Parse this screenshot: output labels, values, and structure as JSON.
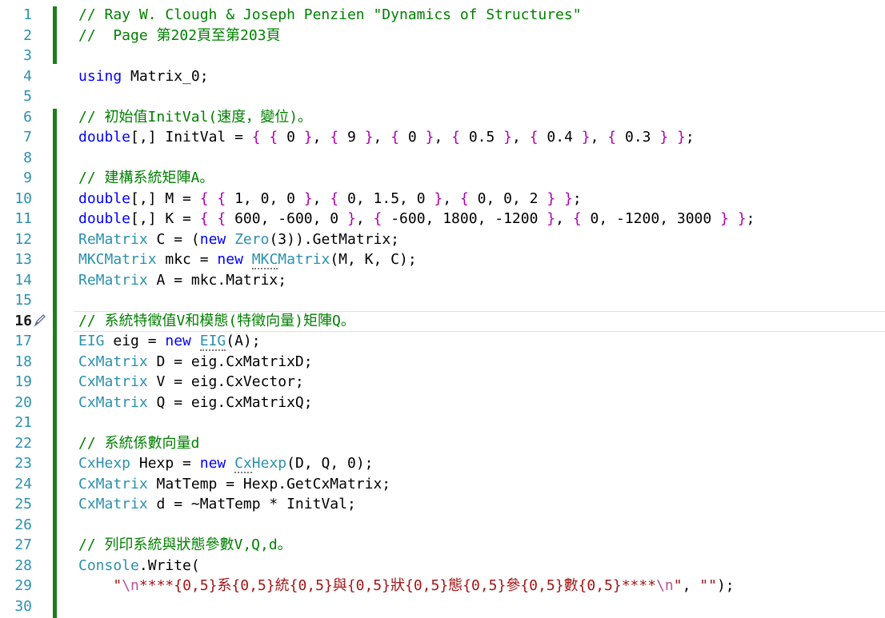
{
  "editor": {
    "colors": {
      "comment": "#008000",
      "keyword": "#0000ff",
      "type": "#2b91af",
      "number": "#098658",
      "string": "#a31515",
      "line_number": "#2b91af",
      "change_bar": "#1a7f1a"
    },
    "current_line": 16,
    "gutter_icon": "pencil-icon",
    "lines": [
      {
        "n": "1",
        "tokens": [
          [
            "c",
            "// Ray W. Clough & Joseph Penzien \"Dynamics of Structures\""
          ]
        ]
      },
      {
        "n": "2",
        "tokens": [
          [
            "c",
            "//  Page 第202頁至第203頁"
          ]
        ]
      },
      {
        "n": "3",
        "tokens": []
      },
      {
        "n": "4",
        "tokens": [
          [
            "k",
            "using"
          ],
          [
            "p",
            " Matrix_0;"
          ]
        ]
      },
      {
        "n": "5",
        "tokens": []
      },
      {
        "n": "6",
        "tokens": [
          [
            "c",
            "// 初始值InitVal(速度，變位)。"
          ]
        ]
      },
      {
        "n": "7",
        "tokens": [
          [
            "k",
            "double"
          ],
          [
            "p",
            "[,] InitVal = "
          ],
          [
            "b",
            "{ { "
          ],
          [
            "p",
            "0"
          ],
          [
            "b",
            " }"
          ],
          [
            "p",
            ", "
          ],
          [
            "b",
            "{ "
          ],
          [
            "p",
            "9"
          ],
          [
            "b",
            " }"
          ],
          [
            "p",
            ", "
          ],
          [
            "b",
            "{ "
          ],
          [
            "p",
            "0"
          ],
          [
            "b",
            " }"
          ],
          [
            "p",
            ", "
          ],
          [
            "b",
            "{ "
          ],
          [
            "p",
            "0.5"
          ],
          [
            "b",
            " }"
          ],
          [
            "p",
            ", "
          ],
          [
            "b",
            "{ "
          ],
          [
            "p",
            "0.4"
          ],
          [
            "b",
            " }"
          ],
          [
            "p",
            ", "
          ],
          [
            "b",
            "{ "
          ],
          [
            "p",
            "0.3"
          ],
          [
            "b",
            " } }"
          ],
          [
            "p",
            ";"
          ]
        ]
      },
      {
        "n": "8",
        "tokens": []
      },
      {
        "n": "9",
        "tokens": [
          [
            "c",
            "// 建構系統矩陣A。"
          ]
        ]
      },
      {
        "n": "10",
        "tokens": [
          [
            "k",
            "double"
          ],
          [
            "p",
            "[,] M = "
          ],
          [
            "b",
            "{ { "
          ],
          [
            "p",
            "1, 0, 0"
          ],
          [
            "b",
            " }"
          ],
          [
            "p",
            ", "
          ],
          [
            "b",
            "{ "
          ],
          [
            "p",
            "0, 1.5, 0"
          ],
          [
            "b",
            " }"
          ],
          [
            "p",
            ", "
          ],
          [
            "b",
            "{ "
          ],
          [
            "p",
            "0, 0, 2"
          ],
          [
            "b",
            " } }"
          ],
          [
            "p",
            ";"
          ]
        ]
      },
      {
        "n": "11",
        "tokens": [
          [
            "k",
            "double"
          ],
          [
            "p",
            "[,] K = "
          ],
          [
            "b",
            "{ { "
          ],
          [
            "p",
            "600, -600, 0"
          ],
          [
            "b",
            " }"
          ],
          [
            "p",
            ", "
          ],
          [
            "b",
            "{ "
          ],
          [
            "p",
            "-600, 1800, -1200"
          ],
          [
            "b",
            " }"
          ],
          [
            "p",
            ", "
          ],
          [
            "b",
            "{ "
          ],
          [
            "p",
            "0, -1200, 3000"
          ],
          [
            "b",
            " } }"
          ],
          [
            "p",
            ";"
          ]
        ]
      },
      {
        "n": "12",
        "tokens": [
          [
            "t",
            "ReMatrix"
          ],
          [
            "p",
            " C = ("
          ],
          [
            "k",
            "new"
          ],
          [
            "p",
            " "
          ],
          [
            "t",
            "Zero"
          ],
          [
            "p",
            "(3)).GetMatrix;"
          ]
        ]
      },
      {
        "n": "13",
        "tokens": [
          [
            "t",
            "MKCMatrix"
          ],
          [
            "p",
            " mkc = "
          ],
          [
            "k",
            "new"
          ],
          [
            "p",
            " "
          ],
          [
            "td",
            "MKC"
          ],
          [
            "t",
            "Matrix"
          ],
          [
            "p",
            "(M, K, C);"
          ]
        ]
      },
      {
        "n": "14",
        "tokens": [
          [
            "t",
            "ReMatrix"
          ],
          [
            "p",
            " A = mkc.Matrix;"
          ]
        ]
      },
      {
        "n": "15",
        "tokens": []
      },
      {
        "n": "16",
        "tokens": [
          [
            "c",
            "// 系統特徵值V和模態(特徵向量)矩陣Q。"
          ]
        ]
      },
      {
        "n": "17",
        "tokens": [
          [
            "t",
            "EIG"
          ],
          [
            "p",
            " eig = "
          ],
          [
            "k",
            "new"
          ],
          [
            "p",
            " "
          ],
          [
            "td",
            "EIG"
          ],
          [
            "p",
            "(A);"
          ]
        ]
      },
      {
        "n": "18",
        "tokens": [
          [
            "t",
            "CxMatrix"
          ],
          [
            "p",
            " D = eig.CxMatrixD;"
          ]
        ]
      },
      {
        "n": "19",
        "tokens": [
          [
            "t",
            "CxMatrix"
          ],
          [
            "p",
            " V = eig.CxVector;"
          ]
        ]
      },
      {
        "n": "20",
        "tokens": [
          [
            "t",
            "CxMatrix"
          ],
          [
            "p",
            " Q = eig.CxMatrixQ;"
          ]
        ]
      },
      {
        "n": "21",
        "tokens": []
      },
      {
        "n": "22",
        "tokens": [
          [
            "c",
            "// 系統係數向量d"
          ]
        ]
      },
      {
        "n": "23",
        "tokens": [
          [
            "t",
            "CxHexp"
          ],
          [
            "p",
            " Hexp = "
          ],
          [
            "k",
            "new"
          ],
          [
            "p",
            " "
          ],
          [
            "td",
            "Cx"
          ],
          [
            "t",
            "Hexp"
          ],
          [
            "p",
            "(D, Q, 0);"
          ]
        ]
      },
      {
        "n": "24",
        "tokens": [
          [
            "t",
            "CxMatrix"
          ],
          [
            "p",
            " MatTemp = Hexp.GetCxMatrix;"
          ]
        ]
      },
      {
        "n": "25",
        "tokens": [
          [
            "t",
            "CxMatrix"
          ],
          [
            "p",
            " d = ~MatTemp * InitVal;"
          ]
        ]
      },
      {
        "n": "26",
        "tokens": []
      },
      {
        "n": "27",
        "tokens": [
          [
            "c",
            "// 列印系統與狀態參數V,Q,d。"
          ]
        ]
      },
      {
        "n": "28",
        "tokens": [
          [
            "t",
            "Console"
          ],
          [
            "p",
            ".Write("
          ]
        ]
      },
      {
        "n": "29",
        "tokens": [
          [
            "p",
            "    "
          ],
          [
            "s",
            "\""
          ],
          [
            "e",
            "\\n"
          ],
          [
            "s",
            "****{0,5}系{0,5}統{0,5}與{0,5}狀{0,5}態{0,5}參{0,5}數{0,5}****"
          ],
          [
            "e",
            "\\n"
          ],
          [
            "s",
            "\""
          ],
          [
            "p",
            ", "
          ],
          [
            "s",
            "\"\""
          ],
          [
            "p",
            ");"
          ]
        ]
      },
      {
        "n": "30",
        "tokens": []
      }
    ]
  }
}
